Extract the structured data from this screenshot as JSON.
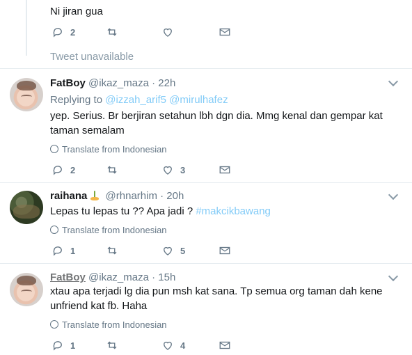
{
  "top_tweet": {
    "text": "Ni jiran gua",
    "reply_count": "2",
    "retweet_count": "",
    "like_count": ""
  },
  "unavailable_label": "Tweet unavailable",
  "tweets": [
    {
      "name": "FatBoy",
      "handle": "@ikaz_maza",
      "time": "· 22h",
      "replying_prefix": "Replying to ",
      "replying_to": "@izzah_arif5 @mirulhafez",
      "text": "yep. Serius. Br berjiran setahun lbh dgn dia. Mmg kenal dan gempar kat taman semalam",
      "translate": "Translate from Indonesian",
      "reply_count": "2",
      "like_count": "3"
    },
    {
      "name": "raihana",
      "handle": "@rhnarhim",
      "time": "· 20h",
      "text_main": "Lepas tu lepas tu ?? Apa jadi ? ",
      "hashtag": "#makcikbawang",
      "translate": "Translate from Indonesian",
      "reply_count": "1",
      "like_count": "5"
    },
    {
      "name": "FatBoy",
      "handle": "@ikaz_maza",
      "time": "· 15h",
      "text": "xtau apa terjadi lg dia pun msh kat sana. Tp semua org taman dah kene unfriend kat fb. Haha",
      "translate": "Translate from Indonesian",
      "reply_count": "1",
      "like_count": "4"
    }
  ],
  "icons": [
    "reply-icon",
    "retweet-icon",
    "like-icon",
    "dm-icon",
    "globe-icon",
    "chevron-down-icon"
  ]
}
